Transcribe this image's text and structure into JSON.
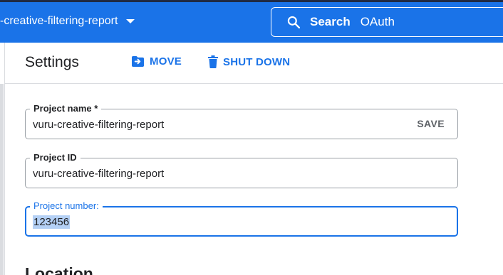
{
  "topbar": {
    "project_label": "-creative-filtering-report",
    "search_label": "Search",
    "search_value": "OAuth"
  },
  "header": {
    "title": "Settings",
    "move_label": "MOVE",
    "shutdown_label": "SHUT DOWN"
  },
  "fields": {
    "project_name": {
      "label": "Project name *",
      "value": "vuru-creative-filtering-report",
      "save_label": "SAVE"
    },
    "project_id": {
      "label": "Project ID",
      "value": "vuru-creative-filtering-report"
    },
    "project_number": {
      "label": "Project number:",
      "value": "123456"
    }
  },
  "section": {
    "heading": "Location"
  },
  "colors": {
    "accent": "#1a73e8",
    "highlight": "#b4d0f5",
    "border": "#9aa0a6"
  }
}
